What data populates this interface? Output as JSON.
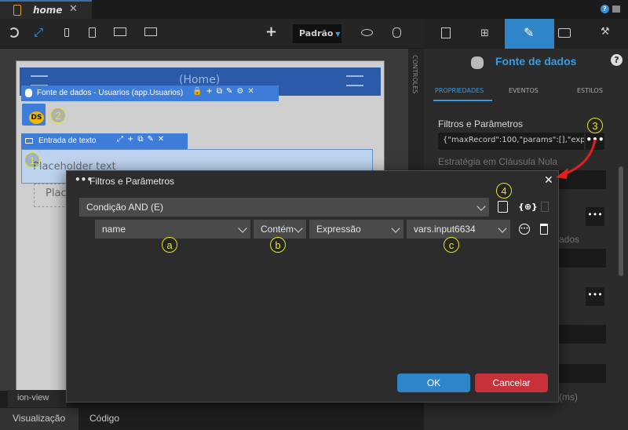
{
  "tabs": {
    "active": "home"
  },
  "toolbar": {
    "device_mode": "Padrão"
  },
  "canvas": {
    "header_title": "(Home)",
    "datasource_label": "Fonte de dados - Usuarios (app.Usuarios)",
    "ds_badge": "DS",
    "input_label": "Entrada de texto",
    "placeholder1": "Placeholder text",
    "placeholder2": "Plac",
    "controls_label": "CONTROLES",
    "ion_view": "ion-view"
  },
  "bottom": {
    "tab_visual": "Visualização",
    "tab_code": "Código"
  },
  "right_panel": {
    "title": "Fonte de dados",
    "subtabs": [
      "PROPRIEDADES",
      "EVENTOS",
      "ESTILOS"
    ],
    "filters_label": "Filtros e Parâmetros",
    "filters_value": "{\"maxRecord\":100,\"params\":[],\"expr",
    "strategy_label": "Estratégia em Cláusula Nula",
    "partial_text1": "ados",
    "partial_text2": "(ms)"
  },
  "dialog": {
    "title": "Filtros e Parâmetros",
    "condition": "Condição AND (E)",
    "field": "name",
    "operator": "Contém",
    "type": "Expressão",
    "value": "vars.input6634",
    "ok_label": "OK",
    "cancel_label": "Cancelar"
  },
  "markers": {
    "m1": "1",
    "m2": "2",
    "m3": "3",
    "m4": "4",
    "ma": "a",
    "mb": "b",
    "mc": "c"
  },
  "colors": {
    "accent": "#2e86c9",
    "cancel": "#c8303a",
    "marker": "#e4e61e",
    "arrow": "#e0201e"
  }
}
